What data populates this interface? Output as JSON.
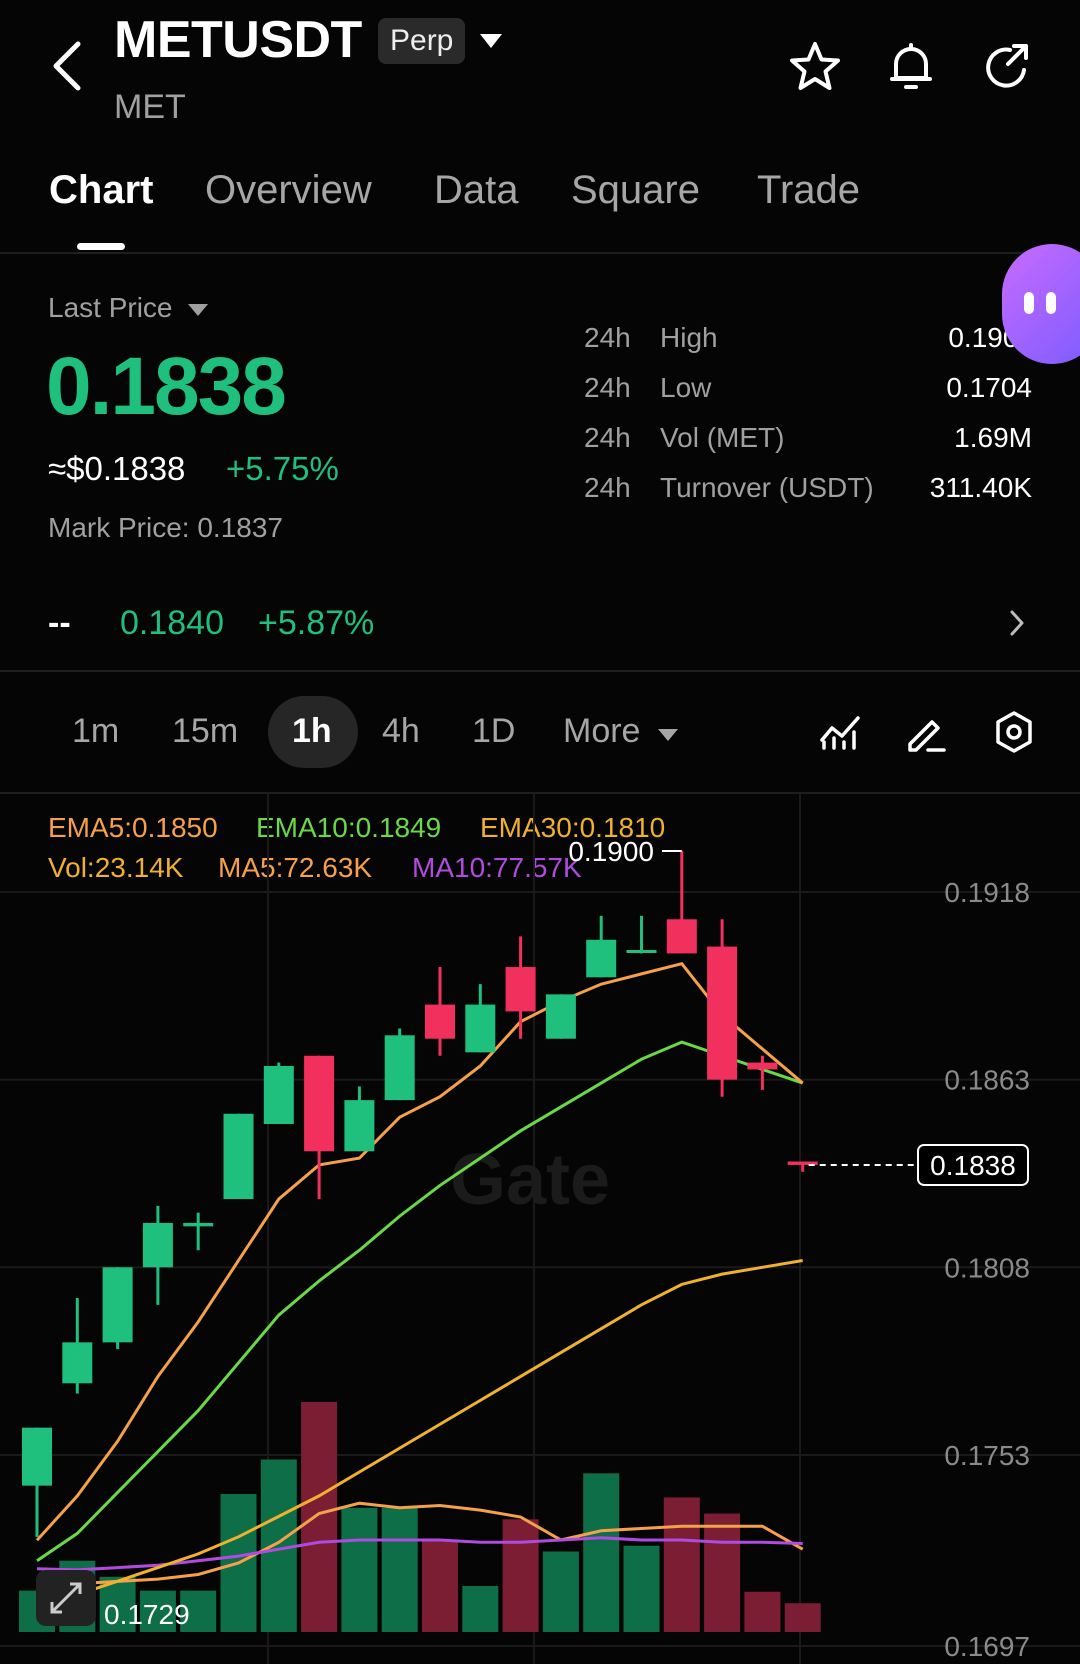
{
  "header": {
    "symbol": "METUSDT",
    "badge": "Perp",
    "subtitle": "MET",
    "icons": [
      "back-icon",
      "star-icon",
      "bell-icon",
      "share-icon"
    ]
  },
  "tabs": [
    "Chart",
    "Overview",
    "Data",
    "Square",
    "Trade"
  ],
  "price": {
    "label": "Last Price",
    "last": "0.1838",
    "usd": "≈$0.1838",
    "change": "+5.75%",
    "mark": "Mark Price: 0.1837"
  },
  "stats": [
    {
      "p": "24h",
      "k": "High",
      "v": "0.1900"
    },
    {
      "p": "24h",
      "k": "Low",
      "v": "0.1704"
    },
    {
      "p": "24h",
      "k": "Vol (MET)",
      "v": "1.69M"
    },
    {
      "p": "24h",
      "k": "Turnover (USDT)",
      "v": "311.40K"
    }
  ],
  "ticker": {
    "dash": "--",
    "price": "0.1840",
    "pct": "+5.87%"
  },
  "intervals": [
    "1m",
    "15m",
    "1h",
    "4h",
    "1D",
    "More"
  ],
  "active_interval": "1h",
  "legend": {
    "ema5": "EMA5:0.1850",
    "ema10": "EMA10:0.1849",
    "ema30": "EMA30:0.1810",
    "vol": "Vol:23.14K",
    "ma5": "MA5:72.63K",
    "ma10": "MA10:77.57K"
  },
  "colors": {
    "up": "#1fbf7e",
    "down": "#f2305e",
    "ema5": "#f5a04a",
    "ema10": "#6ad848",
    "ema30": "#f0b030",
    "ma10": "#b04be0"
  },
  "watermark": "Gate",
  "chart_data": {
    "type": "candlestick",
    "y_ticks": [
      "0.1918",
      "0.1863",
      "0.1808",
      "0.1753",
      "0.1697"
    ],
    "ylim": [
      0.1697,
      0.1918
    ],
    "high_label": "0.1900",
    "low_label": "0.1729",
    "last_label": "0.1838",
    "candles": [
      {
        "o": 0.1744,
        "h": 0.1759,
        "l": 0.1729,
        "c": 0.1761
      },
      {
        "o": 0.1774,
        "h": 0.1799,
        "l": 0.1771,
        "c": 0.1786
      },
      {
        "o": 0.1786,
        "h": 0.1806,
        "l": 0.1784,
        "c": 0.1808
      },
      {
        "o": 0.1808,
        "h": 0.1826,
        "l": 0.1797,
        "c": 0.1821
      },
      {
        "o": 0.182,
        "h": 0.1824,
        "l": 0.1813,
        "c": 0.1821
      },
      {
        "o": 0.1828,
        "h": 0.1853,
        "l": 0.1828,
        "c": 0.1853
      },
      {
        "o": 0.185,
        "h": 0.1868,
        "l": 0.185,
        "c": 0.1867
      },
      {
        "o": 0.187,
        "h": 0.187,
        "l": 0.1828,
        "c": 0.1842
      },
      {
        "o": 0.1842,
        "h": 0.1861,
        "l": 0.1842,
        "c": 0.1857
      },
      {
        "o": 0.1857,
        "h": 0.1878,
        "l": 0.1857,
        "c": 0.1876
      },
      {
        "o": 0.1885,
        "h": 0.1896,
        "l": 0.187,
        "c": 0.1875
      },
      {
        "o": 0.1871,
        "h": 0.1891,
        "l": 0.1871,
        "c": 0.1885
      },
      {
        "o": 0.1896,
        "h": 0.1905,
        "l": 0.1875,
        "c": 0.1883
      },
      {
        "o": 0.1875,
        "h": 0.1888,
        "l": 0.1875,
        "c": 0.1888
      },
      {
        "o": 0.1893,
        "h": 0.1911,
        "l": 0.1893,
        "c": 0.1904
      },
      {
        "o": 0.1901,
        "h": 0.1911,
        "l": 0.19,
        "c": 0.1901
      },
      {
        "o": 0.191,
        "h": 0.193,
        "l": 0.19,
        "c": 0.19
      },
      {
        "o": 0.1902,
        "h": 0.191,
        "l": 0.1858,
        "c": 0.1863
      },
      {
        "o": 0.1868,
        "h": 0.187,
        "l": 0.186,
        "c": 0.1866
      },
      {
        "o": 0.1839,
        "h": 0.1838,
        "l": 0.1836,
        "c": 0.1838
      }
    ],
    "ema5": [
      0.1728,
      0.1741,
      0.1757,
      0.1776,
      0.1792,
      0.181,
      0.1828,
      0.1838,
      0.184,
      0.1852,
      0.1858,
      0.1867,
      0.188,
      0.1886,
      0.1891,
      0.1894,
      0.1897,
      0.1882,
      0.1872,
      0.1862
    ],
    "ema10": [
      0.1722,
      0.173,
      0.1742,
      0.1754,
      0.1766,
      0.178,
      0.1794,
      0.1804,
      0.1813,
      0.1823,
      0.1832,
      0.184,
      0.1848,
      0.1855,
      0.1862,
      0.1869,
      0.1874,
      0.187,
      0.1866,
      0.1862
    ],
    "ema30": [
      0.1709,
      0.1712,
      0.1716,
      0.172,
      0.1724,
      0.1729,
      0.1735,
      0.1741,
      0.1748,
      0.1755,
      0.1762,
      0.1769,
      0.1776,
      0.1783,
      0.179,
      0.1797,
      0.1803,
      0.1806,
      0.1808,
      0.181
    ],
    "volume": [
      36,
      62,
      48,
      36,
      36,
      120,
      150,
      200,
      108,
      108,
      80,
      40,
      98,
      70,
      138,
      75,
      117,
      103,
      35,
      25
    ],
    "ma5_volume": [
      40,
      42,
      44,
      46,
      50,
      60,
      78,
      103,
      112,
      108,
      110,
      106,
      100,
      80,
      88,
      90,
      92,
      92,
      92,
      72
    ],
    "ma10_volume": [
      55,
      54,
      56,
      58,
      62,
      66,
      72,
      78,
      80,
      80,
      80,
      78,
      78,
      80,
      82,
      80,
      80,
      78,
      78,
      77
    ]
  }
}
